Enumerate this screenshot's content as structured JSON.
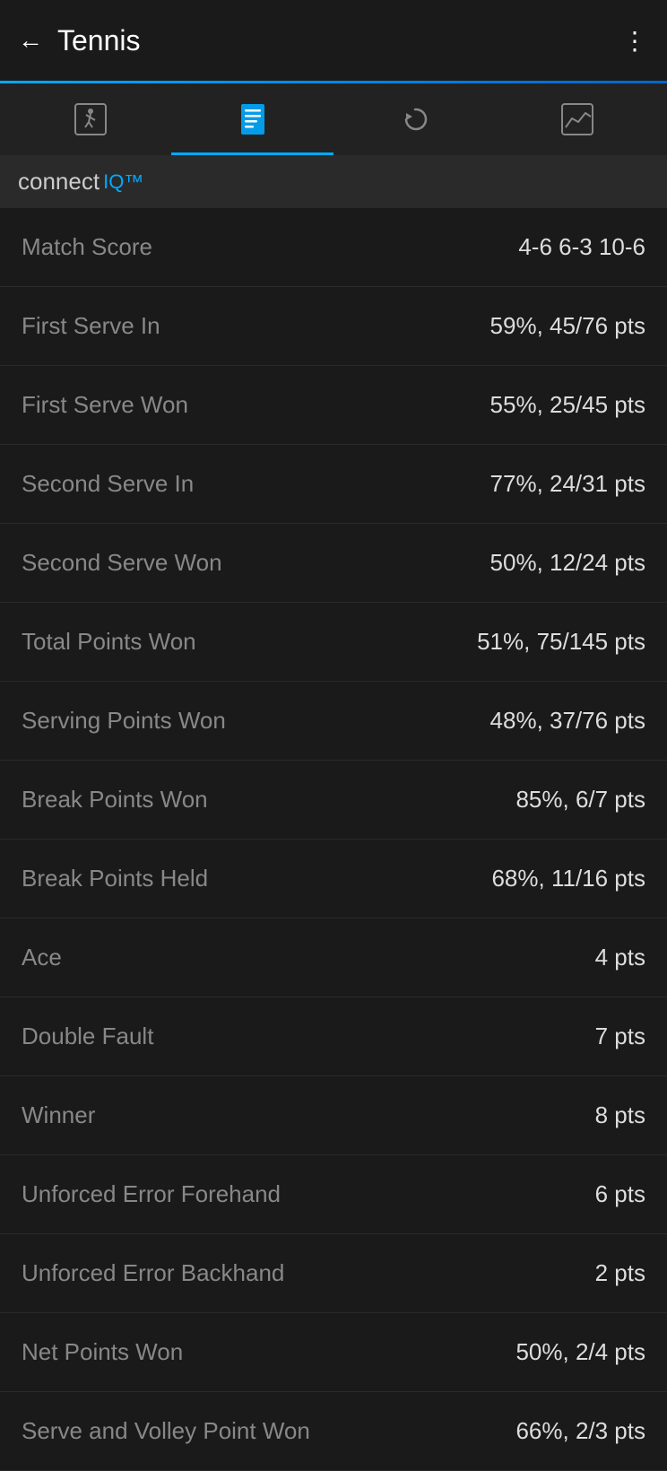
{
  "header": {
    "back_label": "←",
    "title": "Tennis",
    "menu_label": "⋮"
  },
  "tabs": [
    {
      "id": "tab-activity",
      "label": "Activity",
      "active": false
    },
    {
      "id": "tab-stats",
      "label": "Stats",
      "active": true
    },
    {
      "id": "tab-replay",
      "label": "Replay",
      "active": false
    },
    {
      "id": "tab-chart",
      "label": "Chart",
      "active": false
    }
  ],
  "connect_iq": {
    "text": "connect",
    "iq_text": "IQ™"
  },
  "stats": [
    {
      "label": "Match Score",
      "value": "4-6 6-3 10-6"
    },
    {
      "label": "First Serve In",
      "value": "59%, 45/76 pts"
    },
    {
      "label": "First Serve Won",
      "value": "55%, 25/45 pts"
    },
    {
      "label": "Second Serve In",
      "value": "77%, 24/31 pts"
    },
    {
      "label": "Second Serve Won",
      "value": "50%, 12/24 pts"
    },
    {
      "label": "Total Points Won",
      "value": "51%, 75/145 pts"
    },
    {
      "label": "Serving Points Won",
      "value": "48%, 37/76 pts"
    },
    {
      "label": "Break Points Won",
      "value": "85%, 6/7 pts"
    },
    {
      "label": "Break Points Held",
      "value": "68%, 11/16 pts"
    },
    {
      "label": "Ace",
      "value": "4 pts"
    },
    {
      "label": "Double Fault",
      "value": "7 pts"
    },
    {
      "label": "Winner",
      "value": "8 pts"
    },
    {
      "label": "Unforced Error Forehand",
      "value": "6 pts"
    },
    {
      "label": "Unforced Error Backhand",
      "value": "2 pts"
    },
    {
      "label": "Net Points Won",
      "value": "50%, 2/4 pts"
    },
    {
      "label": "Serve and Volley Point Won",
      "value": "66%, 2/3 pts"
    }
  ]
}
